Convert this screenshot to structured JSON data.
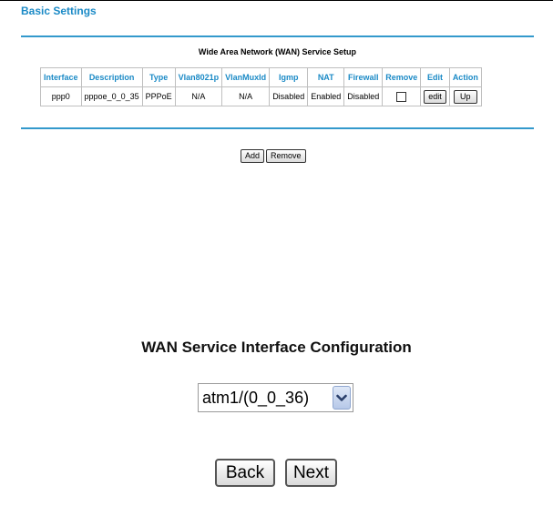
{
  "page_title": "Basic Settings",
  "section_title": "Wide Area Network (WAN) Service Setup",
  "table": {
    "headers": [
      "Interface",
      "Description",
      "Type",
      "Vlan8021p",
      "VlanMuxId",
      "Igmp",
      "NAT",
      "Firewall",
      "Remove",
      "Edit",
      "Action"
    ],
    "row": {
      "interface": "ppp0",
      "description": "pppoe_0_0_35",
      "type": "PPPoE",
      "vlan8021p": "N/A",
      "vlanmuxid": "N/A",
      "igmp": "Disabled",
      "nat": "Enabled",
      "firewall": "Disabled",
      "remove_checked": false,
      "edit_label": "edit",
      "action_label": "Up"
    }
  },
  "buttons": {
    "add": "Add",
    "remove": "Remove",
    "back": "Back",
    "next": "Next"
  },
  "config": {
    "title": "WAN Service Interface Configuration",
    "selected_interface": "atm1/(0_0_36)"
  },
  "colors": {
    "accent": "#1b8ac6",
    "rule": "#3399cc"
  }
}
